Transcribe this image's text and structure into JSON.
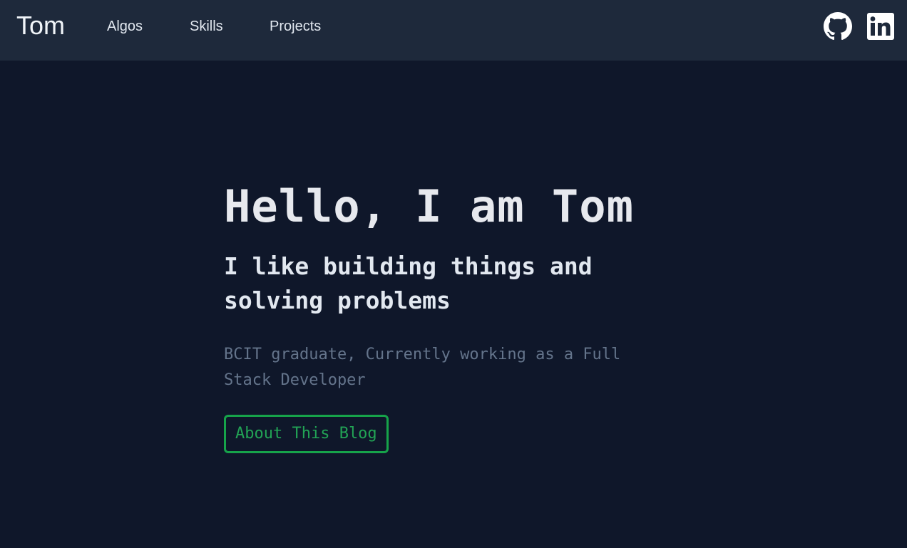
{
  "nav": {
    "brand": "Tom",
    "links": [
      {
        "label": "Algos"
      },
      {
        "label": "Skills"
      },
      {
        "label": "Projects"
      }
    ],
    "social": [
      {
        "icon": "github-icon",
        "label": "GitHub"
      },
      {
        "icon": "linkedin-icon",
        "label": "LinkedIn"
      }
    ]
  },
  "hero": {
    "title": "Hello, I am Tom",
    "subtitle": "I like building things and solving problems",
    "description": "BCIT graduate, Currently working as a Full Stack Developer",
    "button_label": "About This Blog"
  },
  "colors": {
    "page_background": "#0f172a",
    "navbar_background": "#1e293b",
    "accent_green": "#16a34a",
    "muted_text": "#64748b"
  }
}
